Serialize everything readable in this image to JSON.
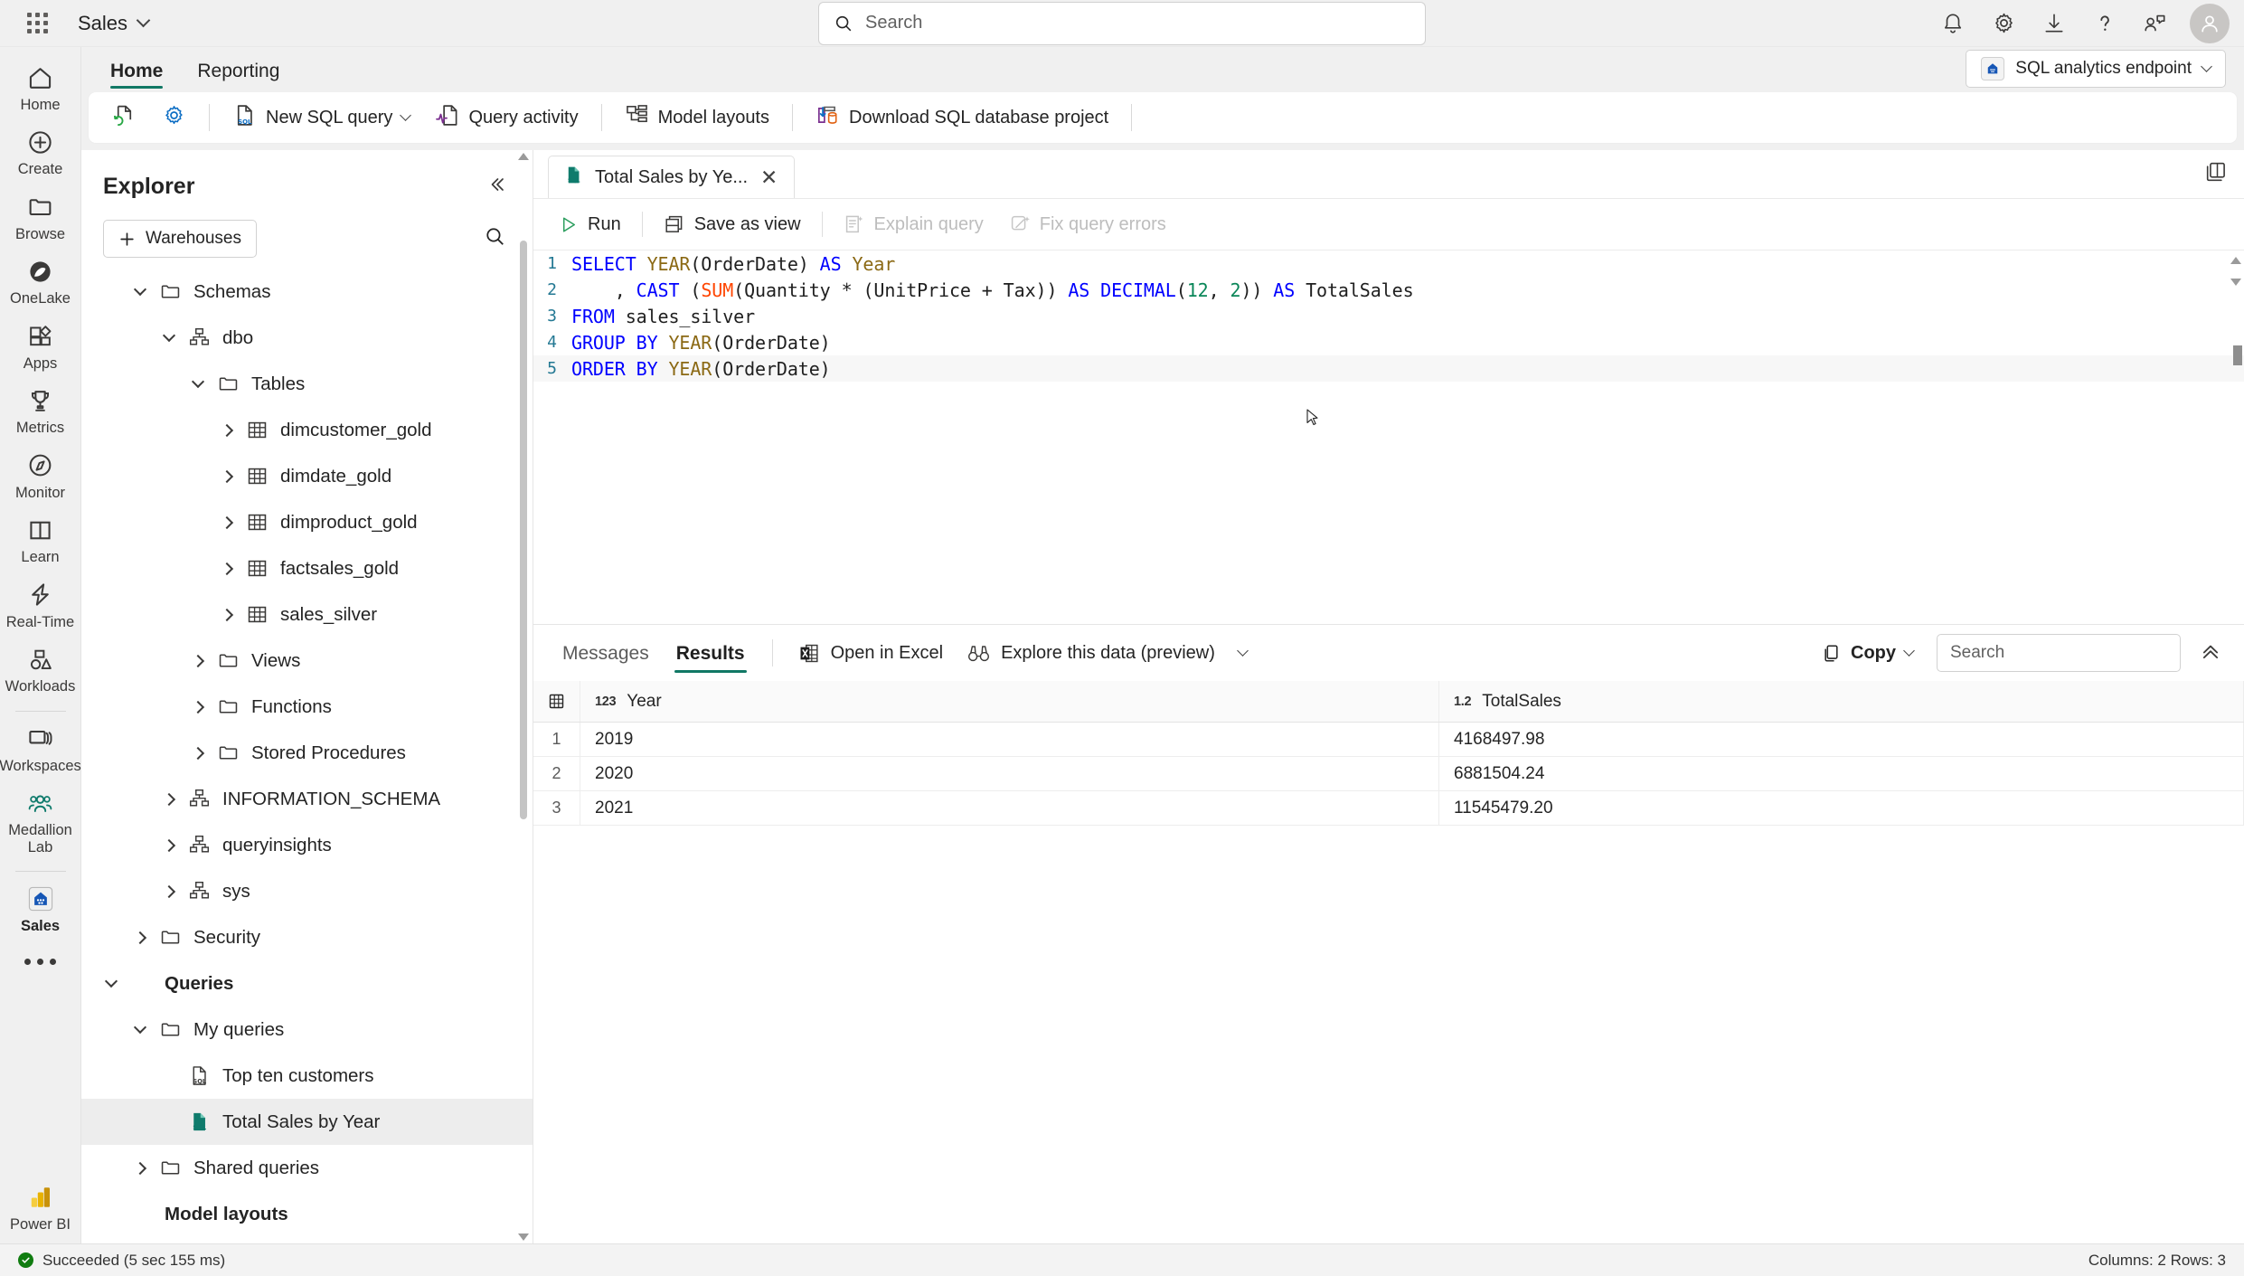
{
  "topbar": {
    "waffle_icon": "app-launcher-icon",
    "workspace": "Sales",
    "search_placeholder": "Search",
    "icons": [
      "notification-bell-icon",
      "gear-icon",
      "download-icon",
      "help-icon",
      "feedback-icon"
    ],
    "avatar_icon": "person-avatar"
  },
  "rail": {
    "items": [
      {
        "label": "Home",
        "icon": "home-icon"
      },
      {
        "label": "Create",
        "icon": "plus-circle-icon"
      },
      {
        "label": "Browse",
        "icon": "folder-icon"
      },
      {
        "label": "OneLake",
        "icon": "onelake-icon"
      },
      {
        "label": "Apps",
        "icon": "apps-icon"
      },
      {
        "label": "Metrics",
        "icon": "trophy-icon"
      },
      {
        "label": "Monitor",
        "icon": "compass-icon"
      },
      {
        "label": "Learn",
        "icon": "book-icon"
      },
      {
        "label": "Real-Time",
        "icon": "lightning-icon"
      },
      {
        "label": "Workloads",
        "icon": "workloads-icon"
      }
    ],
    "items2": [
      {
        "label": "Workspaces",
        "icon": "workspaces-icon"
      },
      {
        "label": "Medallion Lab",
        "icon": "people-icon"
      }
    ],
    "current_workspace": {
      "label": "Sales",
      "icon": "lakehouse-icon"
    },
    "more_icon": "more-dots-icon",
    "footer": {
      "label": "Power BI",
      "icon": "power-bi-icon"
    }
  },
  "ribbon": {
    "tabs": [
      {
        "label": "Home",
        "active": true
      },
      {
        "label": "Reporting",
        "active": false
      }
    ],
    "endpoint": {
      "label": "SQL analytics endpoint",
      "icon": "lakehouse-icon"
    },
    "buttons": [
      {
        "label": "",
        "icon": "refresh-document-icon"
      },
      {
        "label": "",
        "icon": "settings-gear-icon"
      },
      {
        "label": "New SQL query",
        "icon": "sql-file-icon",
        "caret": true
      },
      {
        "label": "Query activity",
        "icon": "query-activity-icon"
      },
      {
        "label": "Model layouts",
        "icon": "model-layouts-icon"
      },
      {
        "label": "Download SQL database project",
        "icon": "download-db-icon"
      }
    ]
  },
  "explorer": {
    "title": "Explorer",
    "collapse_icon": "double-chevron-left-icon",
    "warehouses_button": "Warehouses",
    "search_icon": "search-icon",
    "tree": [
      {
        "label": "Schemas",
        "icon": "folder-icon",
        "twisty": "down",
        "indent": 1
      },
      {
        "label": "dbo",
        "icon": "schema-icon",
        "twisty": "down",
        "indent": 2
      },
      {
        "label": "Tables",
        "icon": "folder-icon",
        "twisty": "down",
        "indent": 3
      },
      {
        "label": "dimcustomer_gold",
        "icon": "table-icon",
        "twisty": "right",
        "indent": 4
      },
      {
        "label": "dimdate_gold",
        "icon": "table-icon",
        "twisty": "right",
        "indent": 4
      },
      {
        "label": "dimproduct_gold",
        "icon": "table-icon",
        "twisty": "right",
        "indent": 4
      },
      {
        "label": "factsales_gold",
        "icon": "table-icon",
        "twisty": "right",
        "indent": 4
      },
      {
        "label": "sales_silver",
        "icon": "table-icon",
        "twisty": "right",
        "indent": 4
      },
      {
        "label": "Views",
        "icon": "folder-icon",
        "twisty": "right",
        "indent": 3
      },
      {
        "label": "Functions",
        "icon": "folder-icon",
        "twisty": "right",
        "indent": 3
      },
      {
        "label": "Stored Procedures",
        "icon": "folder-icon",
        "twisty": "right",
        "indent": 3
      },
      {
        "label": "INFORMATION_SCHEMA",
        "icon": "schema-icon",
        "twisty": "right",
        "indent": 2
      },
      {
        "label": "queryinsights",
        "icon": "schema-icon",
        "twisty": "right",
        "indent": 2
      },
      {
        "label": "sys",
        "icon": "schema-icon",
        "twisty": "right",
        "indent": 2
      },
      {
        "label": "Security",
        "icon": "folder-icon",
        "twisty": "right",
        "indent": 1
      },
      {
        "label": "Queries",
        "icon": "none",
        "twisty": "down",
        "indent": 0,
        "bold": true
      },
      {
        "label": "My queries",
        "icon": "folder-icon",
        "twisty": "down",
        "indent": 1
      },
      {
        "label": "Top ten customers",
        "icon": "sql-file-icon",
        "twisty": "none",
        "indent": 2
      },
      {
        "label": "Total Sales by Year",
        "icon": "sql-file-green-icon",
        "twisty": "none",
        "indent": 2,
        "selected": true
      },
      {
        "label": "Shared queries",
        "icon": "folder-icon",
        "twisty": "right",
        "indent": 1
      },
      {
        "label": "Model layouts",
        "icon": "none",
        "twisty": "none",
        "indent": 0,
        "bold": true
      }
    ]
  },
  "query_tab": {
    "label": "Total Sales by Ye...",
    "icon": "sql-file-green-icon",
    "close_icon": "close-icon",
    "panel_icon": "split-panel-icon"
  },
  "query_toolbar": [
    {
      "label": "Run",
      "icon": "play-icon",
      "disabled": false
    },
    {
      "label": "Save as view",
      "icon": "save-view-icon",
      "disabled": false
    },
    {
      "label": "Explain query",
      "icon": "explain-query-icon",
      "disabled": true
    },
    {
      "label": "Fix query errors",
      "icon": "fix-errors-icon",
      "disabled": true
    }
  ],
  "editor": {
    "lines": [
      {
        "n": "1",
        "tokens": [
          {
            "t": "SELECT ",
            "c": "k"
          },
          {
            "t": "YEAR",
            "c": "fn"
          },
          {
            "t": "(OrderDate) ",
            "c": "id"
          },
          {
            "t": "AS ",
            "c": "k"
          },
          {
            "t": "Year",
            "c": "fn"
          }
        ]
      },
      {
        "n": "2",
        "tokens": [
          {
            "t": "    , ",
            "c": "id"
          },
          {
            "t": "CAST ",
            "c": "k"
          },
          {
            "t": "(",
            "c": "id"
          },
          {
            "t": "SUM",
            "c": "agg"
          },
          {
            "t": "(Quantity * (UnitPrice + Tax)) ",
            "c": "id"
          },
          {
            "t": "AS DECIMAL",
            "c": "k"
          },
          {
            "t": "(",
            "c": "id"
          },
          {
            "t": "12",
            "c": "num"
          },
          {
            "t": ", ",
            "c": "id"
          },
          {
            "t": "2",
            "c": "num"
          },
          {
            "t": ")) ",
            "c": "id"
          },
          {
            "t": "AS ",
            "c": "k"
          },
          {
            "t": "TotalSales",
            "c": "id"
          }
        ]
      },
      {
        "n": "3",
        "tokens": [
          {
            "t": "FROM ",
            "c": "k"
          },
          {
            "t": "sales_silver",
            "c": "id"
          }
        ]
      },
      {
        "n": "4",
        "tokens": [
          {
            "t": "GROUP BY ",
            "c": "k"
          },
          {
            "t": "YEAR",
            "c": "fn"
          },
          {
            "t": "(OrderDate)",
            "c": "id"
          }
        ]
      },
      {
        "n": "5",
        "tokens": [
          {
            "t": "ORDER BY ",
            "c": "k"
          },
          {
            "t": "YEAR",
            "c": "fn"
          },
          {
            "t": "(OrderDate)",
            "c": "id"
          }
        ]
      }
    ]
  },
  "results": {
    "tabs": [
      {
        "label": "Messages",
        "active": false
      },
      {
        "label": "Results",
        "active": true
      }
    ],
    "buttons": [
      {
        "label": "Open in Excel",
        "icon": "excel-icon"
      },
      {
        "label": "Explore this data (preview)",
        "icon": "binoculars-icon"
      }
    ],
    "overflow_icon": "chevron-down-icon",
    "copy_label": "Copy",
    "copy_icon": "copy-icon",
    "search_placeholder": "Search",
    "collapse_icon": "double-chevron-up-icon",
    "grid_icon": "grid-icon",
    "columns": [
      {
        "name": "Year",
        "type_tag": "123"
      },
      {
        "name": "TotalSales",
        "type_tag": "1.2"
      }
    ],
    "rows": [
      {
        "index": "1",
        "Year": "2019",
        "TotalSales": "4168497.98"
      },
      {
        "index": "2",
        "Year": "2020",
        "TotalSales": "6881504.24"
      },
      {
        "index": "3",
        "Year": "2021",
        "TotalSales": "11545479.20"
      }
    ]
  },
  "statusbar": {
    "status": "Succeeded (5 sec 155 ms)",
    "status_icon": "success-check-icon",
    "counts": "Columns: 2 Rows: 3"
  },
  "colors": {
    "accent_teal": "#117865",
    "success_green": "#107c10",
    "sql_blue": "#0078d4",
    "keyword_blue": "#0000ff",
    "linenum_blue": "#237893"
  }
}
